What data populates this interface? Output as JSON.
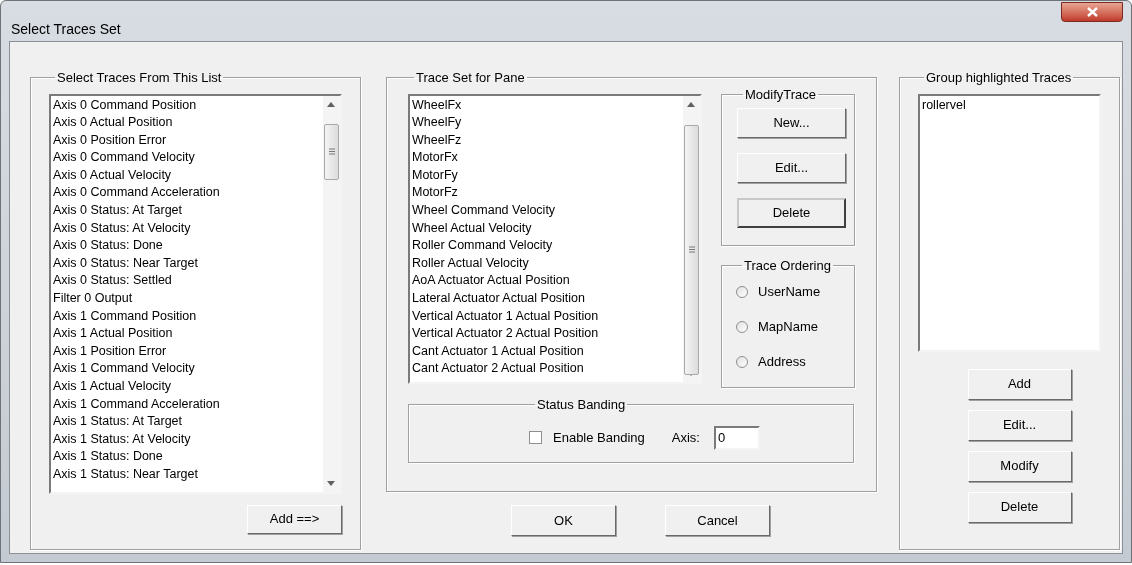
{
  "window": {
    "title": "Select Traces Set"
  },
  "source_group": {
    "title": "Select Traces From This List",
    "items": [
      "Axis 0 Command Position",
      "Axis 0 Actual Position",
      "Axis 0 Position Error",
      "Axis 0 Command Velocity",
      "Axis 0 Actual Velocity",
      "Axis 0 Command Acceleration",
      "Axis 0 Status: At Target",
      "Axis 0 Status: At Velocity",
      "Axis 0 Status: Done",
      "Axis 0 Status: Near Target",
      "Axis 0 Status: Settled",
      "Filter 0 Output",
      "Axis 1 Command Position",
      "Axis 1 Actual Position",
      "Axis 1 Position Error",
      "Axis 1 Command Velocity",
      "Axis 1 Actual Velocity",
      "Axis 1 Command Acceleration",
      "Axis 1 Status: At Target",
      "Axis 1 Status: At Velocity",
      "Axis 1 Status: Done",
      "Axis 1 Status: Near Target"
    ],
    "add_button": "Add ==>"
  },
  "trace_set": {
    "title": "Trace Set for Pane",
    "items": [
      "WheelFx",
      "WheelFy",
      "WheelFz",
      "MotorFx",
      "MotorFy",
      "MotorFz",
      "Wheel Command Velocity",
      "Wheel Actual Velocity",
      "Roller Command Velocity",
      "Roller Actual Velocity",
      "AoA Actuator Actual Position",
      "Lateral Actuator Actual Position",
      "Vertical Actuator 1 Actual Position",
      "Vertical Actuator 2 Actual Position",
      "Cant Actuator 1 Actual Position",
      "Cant Actuator 2 Actual Position"
    ],
    "modify_trace": {
      "title": "ModifyTrace",
      "buttons": [
        {
          "label": "New...",
          "default": false
        },
        {
          "label": "Edit...",
          "default": false
        },
        {
          "label": "Delete",
          "default": true
        }
      ]
    },
    "trace_ordering": {
      "title": "Trace Ordering",
      "options": [
        {
          "label": "UserName",
          "selected": false
        },
        {
          "label": "MapName",
          "selected": false
        },
        {
          "label": "Address",
          "selected": false
        }
      ]
    },
    "status_banding": {
      "title": "Status Banding",
      "enable_banding": {
        "label": "Enable Banding",
        "checked": false
      },
      "axis": {
        "label": "Axis:",
        "value": "0"
      }
    }
  },
  "group_group": {
    "title": "Group highlighted Traces",
    "items": [
      "rollervel"
    ],
    "buttons": [
      "Add",
      "Edit...",
      "Modify",
      "Delete"
    ]
  },
  "footer_buttons": [
    "OK",
    "Cancel"
  ]
}
